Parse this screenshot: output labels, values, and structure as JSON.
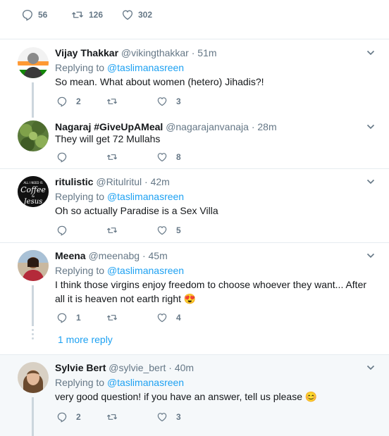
{
  "top_actions": {
    "replies": "56",
    "retweets": "126",
    "likes": "302"
  },
  "tweets": [
    {
      "name": "Vijay Thakkar",
      "handle": "@vikingthakkar",
      "time": "51m",
      "replying_label": "Replying to",
      "replying_to": "@taslimanasreen",
      "text": "So mean. What about women (hetero) Jihadis?!",
      "replies": "2",
      "retweets": "",
      "likes": "3"
    },
    {
      "name": "Nagaraj #GiveUpAMeal",
      "handle": "@nagarajanvanaja",
      "time": "28m",
      "text": "They will get 72 Mullahs",
      "replies": "",
      "retweets": "",
      "likes": "8"
    },
    {
      "name": "ritulistic",
      "handle": "@Ritulritul",
      "time": "42m",
      "replying_label": "Replying to",
      "replying_to": "@taslimanasreen",
      "text": "Oh so actually Paradise is a Sex Villa",
      "replies": "",
      "retweets": "",
      "likes": "5",
      "avatar_text": "ALL I NEED IS Coffee & Jesus"
    },
    {
      "name": "Meena",
      "handle": "@meenabg",
      "time": "45m",
      "replying_label": "Replying to",
      "replying_to": "@taslimanasreen",
      "text": "I think those virgins enjoy freedom to choose whoever they want... After all it is heaven not earth right 😍",
      "replies": "1",
      "retweets": "",
      "likes": "4"
    },
    {
      "name": "Sylvie Bert",
      "handle": "@sylvie_bert",
      "time": "40m",
      "replying_label": "Replying to",
      "replying_to": "@taslimanasreen",
      "text": "very good question! if you have an answer, tell us please 😊",
      "replies": "2",
      "retweets": "",
      "likes": "3"
    }
  ],
  "more_replies": "1 more reply",
  "colors": {
    "link": "#1da1f2",
    "muted": "#657786",
    "border": "#e6ecf0",
    "highlight_bg": "#f5f8fa"
  },
  "icons": [
    "reply-icon",
    "retweet-icon",
    "heart-icon",
    "chevron-down-icon"
  ]
}
